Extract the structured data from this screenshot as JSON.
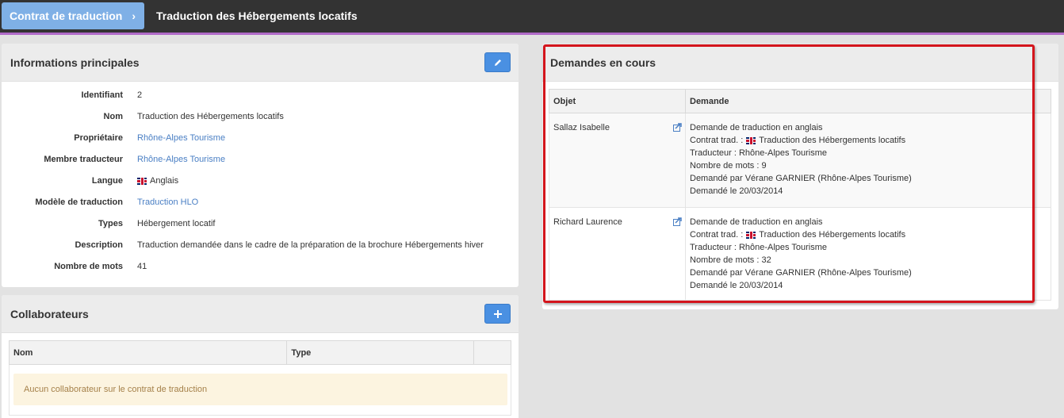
{
  "breadcrumb": {
    "parent": "Contrat de traduction",
    "current": "Traduction des Hébergements locatifs"
  },
  "info_panel": {
    "title": "Informations principales",
    "rows": [
      {
        "label": "Identifiant",
        "value": "2"
      },
      {
        "label": "Nom",
        "value": "Traduction des Hébergements locatifs"
      },
      {
        "label": "Propriétaire",
        "value": "Rhône-Alpes Tourisme"
      },
      {
        "label": "Membre traducteur",
        "value": "Rhône-Alpes Tourisme"
      },
      {
        "label": "Langue",
        "value": "Anglais",
        "icon": "uk-flag-icon"
      },
      {
        "label": "Modèle de traduction",
        "value": "Traduction HLO"
      },
      {
        "label": "Types",
        "value": "Hébergement locatif"
      },
      {
        "label": "Description",
        "value": "Traduction demandée dans le cadre de la préparation de la brochure Hébergements hiver"
      },
      {
        "label": "Nombre de mots",
        "value": "41"
      }
    ]
  },
  "collab_panel": {
    "title": "Collaborateurs",
    "columns": [
      "Nom",
      "Type"
    ],
    "empty_message": "Aucun collaborateur sur le contrat de traduction"
  },
  "requests_panel": {
    "title": "Demandes en cours",
    "columns": [
      "Objet",
      "Demande"
    ],
    "rows": [
      {
        "objet": "Sallaz Isabelle",
        "lines": {
          "type": "Demande de traduction en anglais",
          "contrat_prefix": "Contrat trad. :",
          "contrat": "Traduction des Hébergements locatifs",
          "traducteur": "Traducteur : Rhône-Alpes Tourisme",
          "mots": "Nombre de mots : 9",
          "par": "Demandé par Vérane GARNIER (Rhône-Alpes Tourisme)",
          "date": "Demandé le 20/03/2014"
        }
      },
      {
        "objet": "Richard Laurence",
        "lines": {
          "type": "Demande de traduction en anglais",
          "contrat_prefix": "Contrat trad. :",
          "contrat": "Traduction des Hébergements locatifs",
          "traducteur": "Traducteur : Rhône-Alpes Tourisme",
          "mots": "Nombre de mots : 32",
          "par": "Demandé par Vérane GARNIER (Rhône-Alpes Tourisme)",
          "date": "Demandé le 20/03/2014"
        }
      }
    ]
  },
  "colors": {
    "accent": "#4a90e2",
    "topbar": "#333333",
    "topbar_underline": "#b06ac8",
    "link": "#4a7fc4",
    "highlight": "#d4151c"
  }
}
